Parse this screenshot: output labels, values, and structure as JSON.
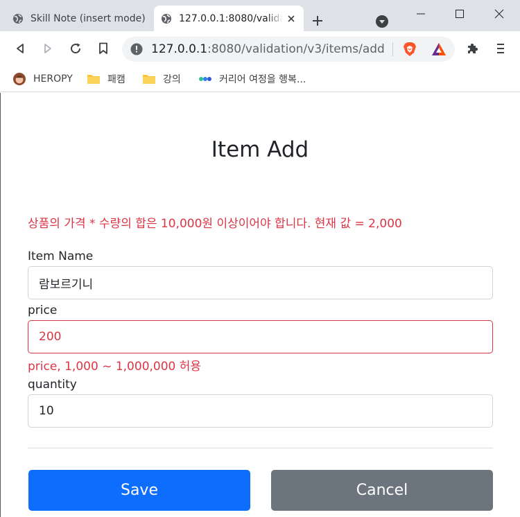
{
  "browser": {
    "tabs": [
      {
        "title": "Skill Note (insert mode)",
        "active": false
      },
      {
        "title": "127.0.0.1:8080/validation/v3/items/add",
        "active": true
      }
    ],
    "address": {
      "host": "127.0.0.1",
      "path": ":8080/validation/v3/items/add"
    },
    "bookmarks": [
      {
        "label": "HEROPY",
        "icon": "avatar-icon"
      },
      {
        "label": "패캠",
        "icon": "folder-icon"
      },
      {
        "label": "강의",
        "icon": "folder-icon"
      },
      {
        "label": "커리어 여정을 행복...",
        "icon": "dots-logo-icon"
      }
    ]
  },
  "page": {
    "title": "Item Add",
    "global_error": "상품의 가격 * 수량의 합은 10,000원 이상이어야 합니다. 현재 값 = 2,000",
    "fields": {
      "item_name": {
        "label": "Item Name",
        "value": "람보르기니"
      },
      "price": {
        "label": "price",
        "value": "200",
        "error": "price, 1,000 ~ 1,000,000 허용"
      },
      "quantity": {
        "label": "quantity",
        "value": "10"
      }
    },
    "buttons": {
      "save": "Save",
      "cancel": "Cancel"
    }
  },
  "colors": {
    "error": "#dc3545",
    "primary": "#0d6efd",
    "secondary": "#6c757d"
  }
}
